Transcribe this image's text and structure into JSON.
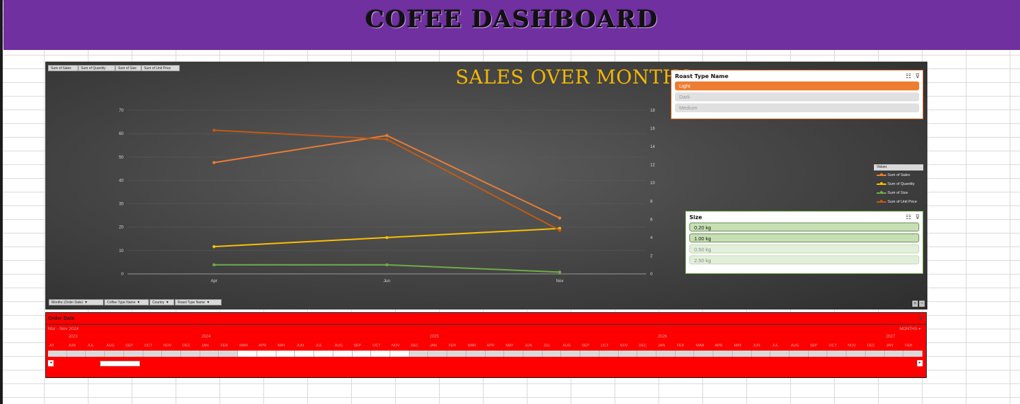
{
  "dashboard": {
    "title": "COFEE DASHBOARD"
  },
  "colors": {
    "header_bg": "#7030a0",
    "chart_title": "#f2b705",
    "sales": "#ed7d31",
    "quantity": "#ffc000",
    "size": "#70ad47",
    "unit_price": "#c55a11",
    "timeline_bg": "#ff0000"
  },
  "value_buttons": [
    "Sum of Sales",
    "Sum of Quantity",
    "Sum of Size",
    "Sum of Unit Price"
  ],
  "axis_buttons": [
    "Months (Order Date)",
    "Coffee Type Name",
    "Country",
    "Roast Type Name"
  ],
  "chart_data": {
    "type": "line",
    "title": "SALES OVER MONTHS",
    "categories": [
      "Apr",
      "Jun",
      "Nov"
    ],
    "y_left": {
      "ticks": [
        0,
        10,
        20,
        30,
        40,
        50,
        60,
        70
      ],
      "ylim": [
        0,
        70
      ]
    },
    "y_right": {
      "ticks": [
        0,
        2,
        4,
        6,
        8,
        10,
        12,
        14,
        16,
        18
      ],
      "ylim": [
        0,
        18
      ]
    },
    "series": [
      {
        "name": "Sum of Sales",
        "axis": "left",
        "values": [
          47.6,
          59.2,
          23.9
        ],
        "color": "#ed7d31"
      },
      {
        "name": "Sum of Quantity",
        "axis": "right",
        "values": [
          3,
          4,
          5
        ],
        "color": "#ffc000"
      },
      {
        "name": "Sum of Size",
        "axis": "right",
        "values": [
          1,
          1,
          0.2
        ],
        "color": "#70ad47"
      },
      {
        "name": "Sum of Unit Price",
        "axis": "right",
        "values": [
          15.8,
          14.8,
          4.8
        ],
        "color": "#c55a11"
      }
    ],
    "legend": {
      "title": "Values",
      "position": "right"
    },
    "grid": true
  },
  "roast_slicer": {
    "title": "Roast Type Name",
    "items": [
      {
        "label": "Light",
        "selected": true
      },
      {
        "label": "Dark",
        "selected": false
      },
      {
        "label": "Medium",
        "selected": false
      }
    ]
  },
  "size_slicer": {
    "title": "Size",
    "items": [
      {
        "label": "0.20 kg",
        "selected": true
      },
      {
        "label": "1.00 kg",
        "selected": true
      },
      {
        "label": "0.50 kg",
        "selected": false
      },
      {
        "label": "2.50 kg",
        "selected": false
      }
    ]
  },
  "timeline": {
    "title": "Order Date",
    "range": "Mar - Nov 2024",
    "level": "MONTHS",
    "years": [
      "2023",
      "2024",
      "2025",
      "2026",
      "2027"
    ],
    "months": [
      "AY",
      "JUN",
      "JUL",
      "AUG",
      "SEP",
      "OCT",
      "NOV",
      "DEC",
      "JAN",
      "FEB",
      "MAR",
      "APR",
      "MAY",
      "JUN",
      "JUL",
      "AUG",
      "SEP",
      "OCT",
      "NOV",
      "DEC",
      "JAN",
      "FEB",
      "MAR",
      "APR",
      "MAY",
      "JUN",
      "JUL",
      "AUG",
      "SEP",
      "OCT",
      "NOV",
      "DEC",
      "JAN",
      "FEB",
      "MAR",
      "APR",
      "MAY",
      "JUN",
      "JUL",
      "AUG",
      "SEP",
      "OCT",
      "NOV",
      "DEC",
      "JAN",
      "FEB"
    ],
    "selected_start": 10,
    "selected_end": 18
  }
}
